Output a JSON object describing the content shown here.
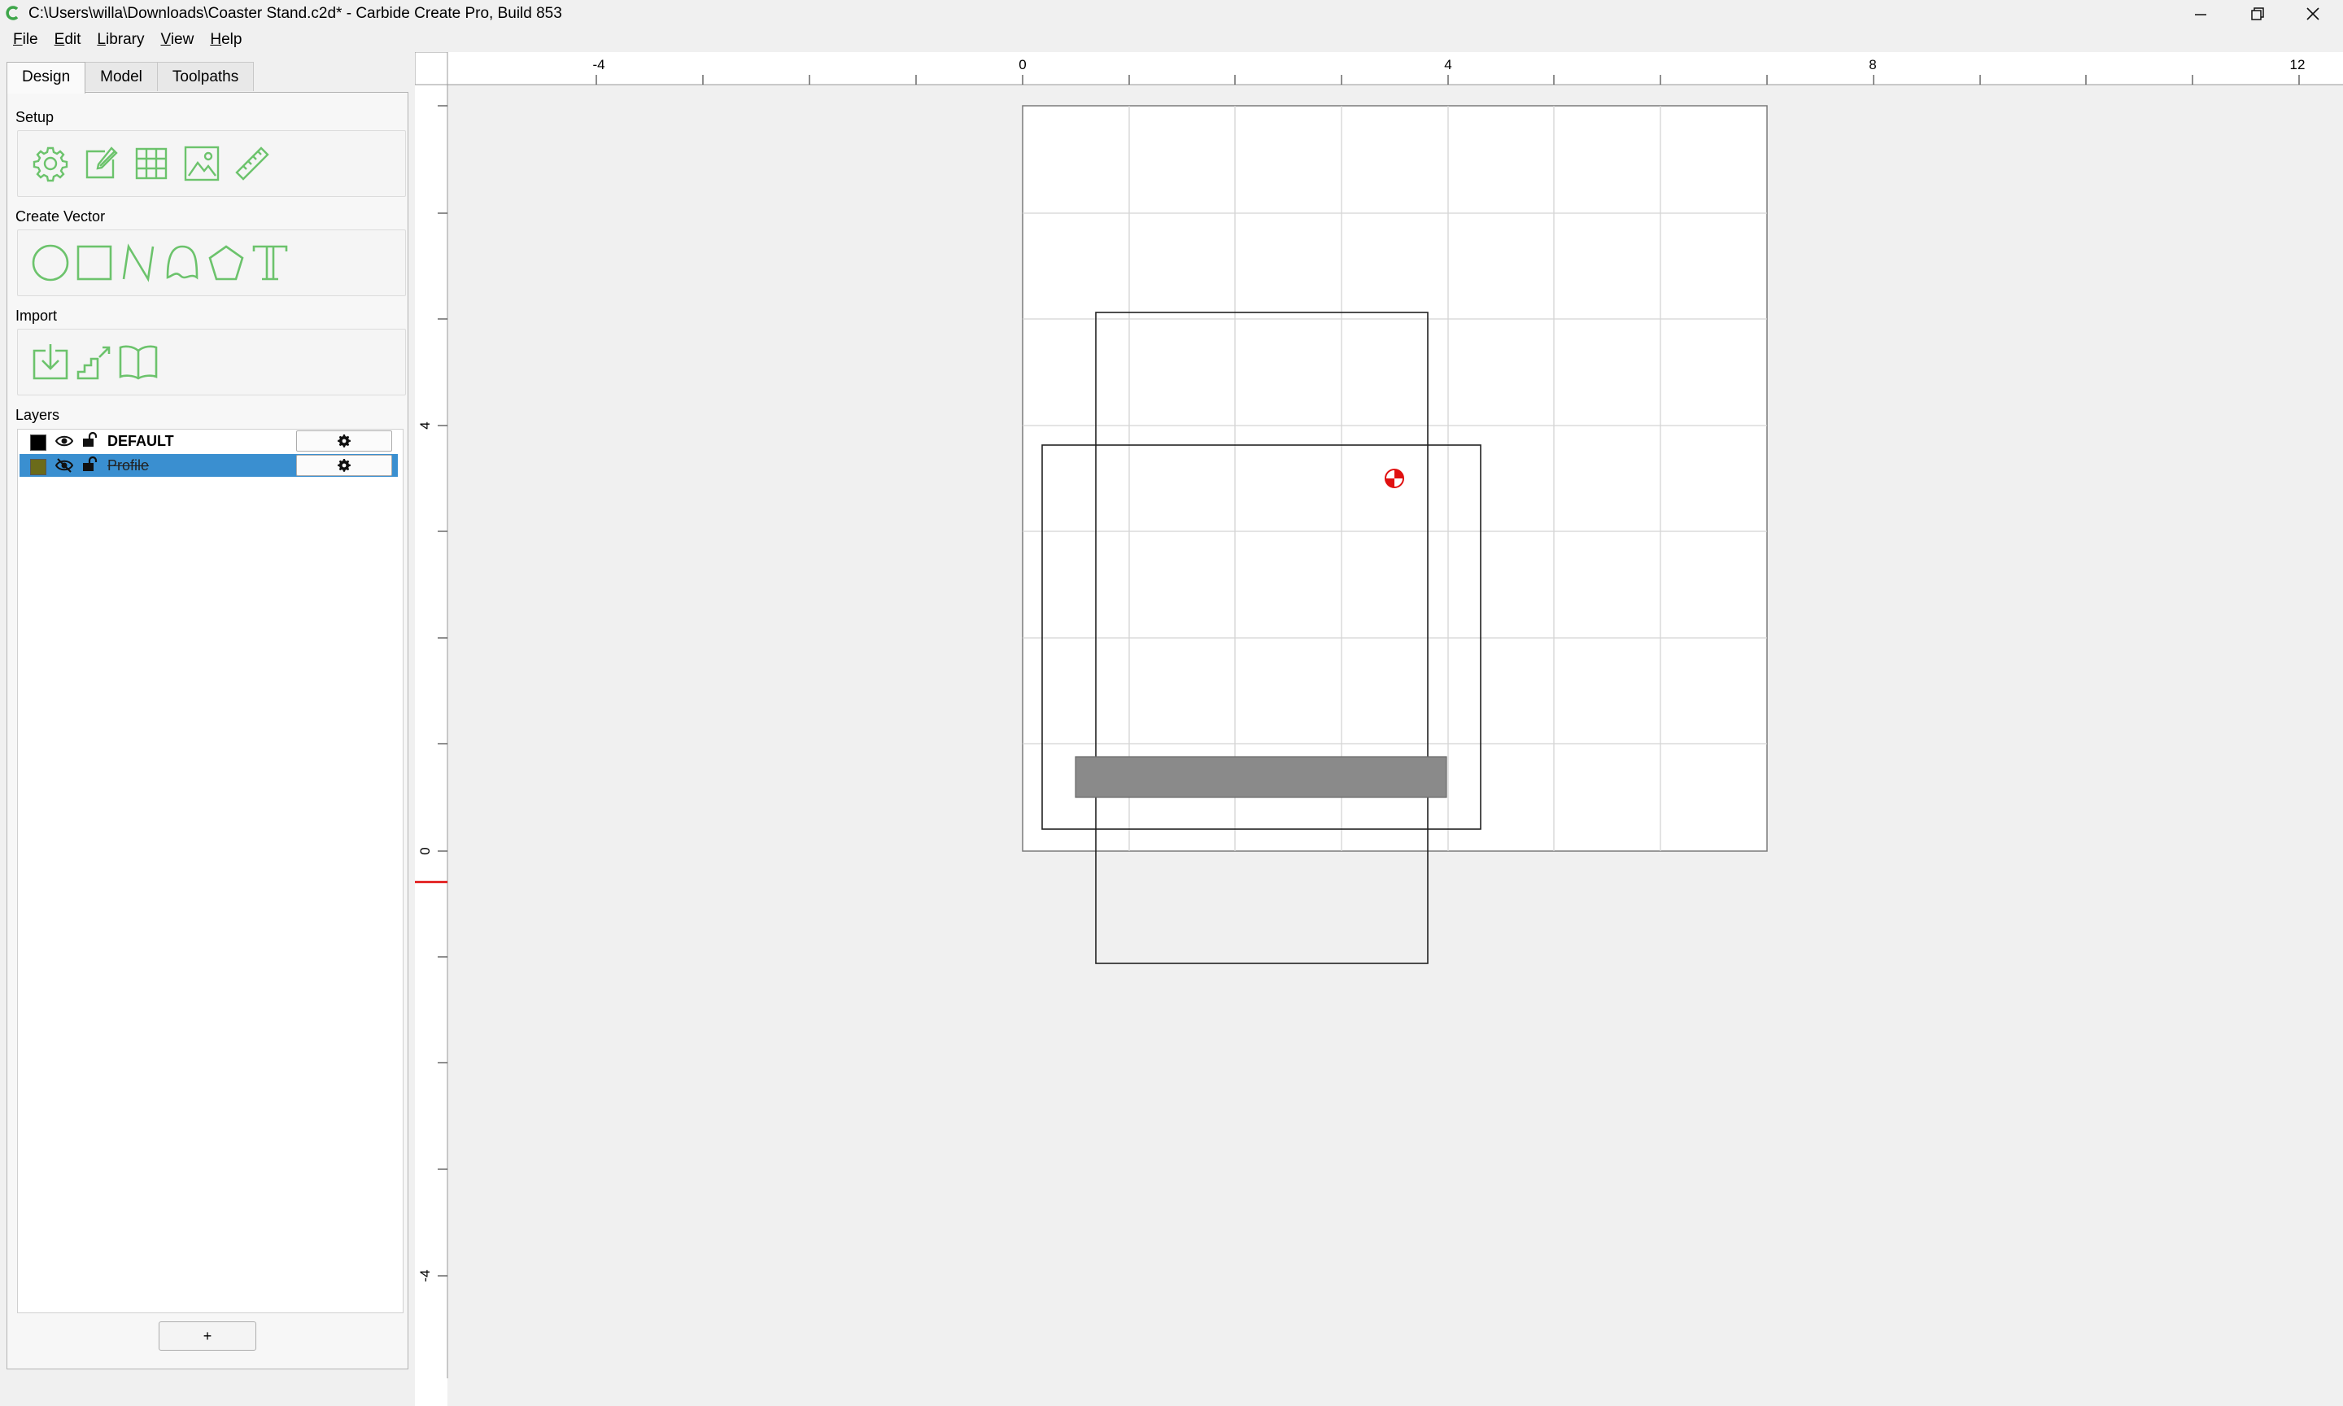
{
  "window": {
    "title": "C:\\Users\\willa\\Downloads\\Coaster Stand.c2d* - Carbide Create Pro, Build 853"
  },
  "menu": [
    {
      "label": "File",
      "key": "F",
      "rest": "ile"
    },
    {
      "label": "Edit",
      "key": "E",
      "rest": "dit"
    },
    {
      "label": "Library",
      "key": "L",
      "rest": "ibrary"
    },
    {
      "label": "View",
      "key": "V",
      "rest": "iew"
    },
    {
      "label": "Help",
      "key": "H",
      "rest": "elp"
    }
  ],
  "tabs": [
    "Design",
    "Model",
    "Toolpaths"
  ],
  "sections": {
    "setup": "Setup",
    "create_vector": "Create Vector",
    "import": "Import",
    "layers": "Layers"
  },
  "tools": {
    "setup": [
      "gear-icon",
      "edit-icon",
      "grid-icon",
      "image-icon",
      "ruler-icon"
    ],
    "create_vector": [
      "circle-icon",
      "rectangle-icon",
      "polyline-icon",
      "curve-icon",
      "polygon-icon",
      "text-icon"
    ],
    "import": [
      "import-icon",
      "import-3d-icon",
      "library-icon"
    ]
  },
  "layers": [
    {
      "name": "DEFAULT",
      "color": "#000000",
      "visible": true,
      "locked": false,
      "selected": false
    },
    {
      "name": "Profile",
      "color": "#6b6b1a",
      "visible": false,
      "locked": false,
      "selected": true
    }
  ],
  "add_layer_label": "+",
  "ruler": {
    "top_labels": [
      "-4",
      "0",
      "4",
      "8",
      "12"
    ],
    "left_labels": [
      "4",
      "0",
      "-4"
    ]
  },
  "colors": {
    "accent_green": "#6cc36c",
    "selection_blue": "#3a8fd0",
    "origin_red": "#e01010"
  }
}
